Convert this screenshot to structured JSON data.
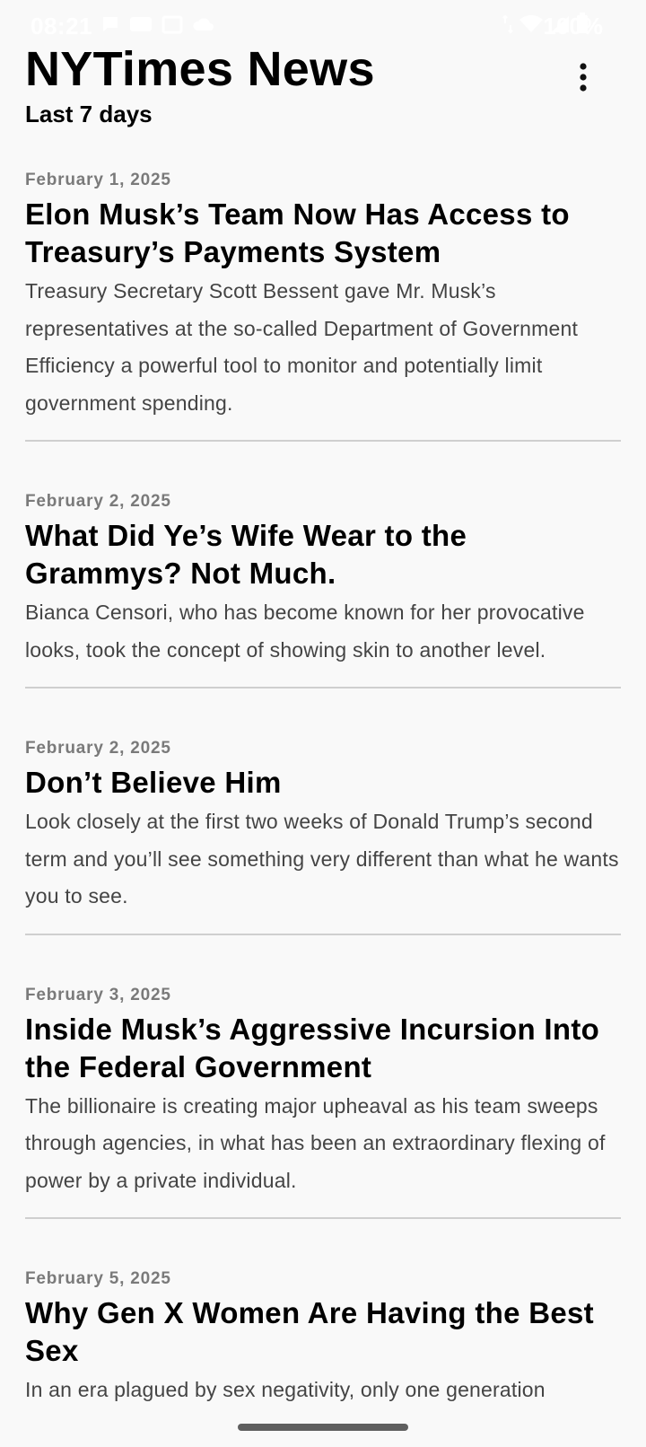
{
  "status_bar": {
    "time": "08:21",
    "battery": "100%",
    "left_icons": [
      "chat-bubble-icon",
      "message-icon",
      "calendar-icon",
      "cloud-icon"
    ],
    "right_icons": [
      "data-arrows-icon",
      "wifi-icon",
      "cellular-signal-icon",
      "battery-icon"
    ]
  },
  "header": {
    "title": "NYTimes News",
    "subtitle": "Last 7 days",
    "menu_icon": "more-vertical-icon"
  },
  "articles": [
    {
      "date": "February 1, 2025",
      "title": "Elon Musk’s Team Now Has Access to Treasury’s Payments System",
      "summary": "Treasury Secretary Scott Bessent gave Mr. Musk’s representatives at the so-called Department of Government Efficiency a powerful tool to monitor and potentially limit government spending."
    },
    {
      "date": "February 2, 2025",
      "title": "What Did Ye’s Wife Wear to the Grammys? Not Much.",
      "summary": "Bianca Censori, who has become known for her provocative looks, took the concept of showing skin to another level."
    },
    {
      "date": "February 2, 2025",
      "title": "Don’t Believe Him",
      "summary": "Look closely at the first two weeks of Donald Trump’s second term and you’ll see something very different than what he wants you to see."
    },
    {
      "date": "February 3, 2025",
      "title": "Inside Musk’s Aggressive Incursion Into the Federal Government",
      "summary": "The billionaire is creating major upheaval as his team sweeps through agencies, in what has been an extraordinary flexing of power by a private individual."
    },
    {
      "date": "February 5, 2025",
      "title": "Why Gen X Women Are Having the Best Sex",
      "summary": "In an era plagued by sex negativity, only one generation"
    }
  ]
}
